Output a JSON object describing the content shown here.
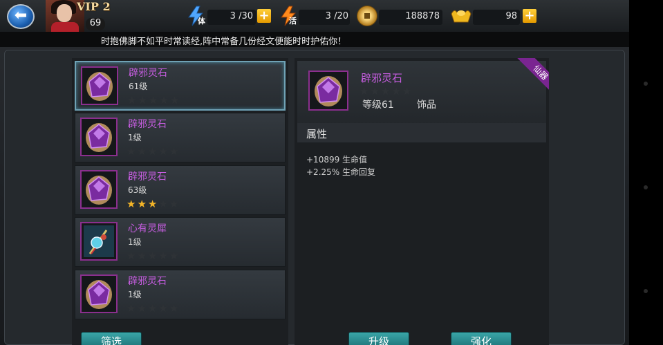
{
  "header": {
    "vip": "VIP 2",
    "level": "69",
    "stamina": {
      "icon_text": "体",
      "value": "3 /30"
    },
    "energy": {
      "icon_text": "活",
      "value": "3 /20"
    },
    "coins": "188878",
    "ingots": "98"
  },
  "tip": "时抱佛脚不如平时常读经,阵中常备几份经文便能时时护佑你！",
  "items": [
    {
      "name": "辟邪灵石",
      "level": "61级",
      "stars": 0,
      "selected": true
    },
    {
      "name": "辟邪灵石",
      "level": "1级",
      "stars": 0
    },
    {
      "name": "辟邪灵石",
      "level": "63级",
      "stars": 3
    },
    {
      "name": "心有灵犀",
      "level": "1级",
      "stars": 0
    },
    {
      "name": "辟邪灵石",
      "level": "1级",
      "stars": 0
    }
  ],
  "detail": {
    "name": "辟邪灵石",
    "badge": "仙器",
    "level": "等级61",
    "type": "饰品",
    "stars": 0,
    "attr_title": "属性",
    "attrs": [
      "+10899 生命值",
      "+2.25% 生命回复"
    ]
  },
  "buttons": {
    "filter": "筛选",
    "upgrade": "升级",
    "enhance": "强化"
  },
  "colors": {
    "rarity_purple": "#c65de0",
    "star_gold": "#f4b528",
    "button_teal": "#2b8d90"
  },
  "icons": {
    "back": "back-arrow-icon",
    "stamina": "lightning-icon",
    "energy": "flame-icon",
    "coin": "coin-icon",
    "ingot": "gold-ingot-icon",
    "gem": "purple-gem-icon",
    "charm": "jade-charm-icon"
  }
}
